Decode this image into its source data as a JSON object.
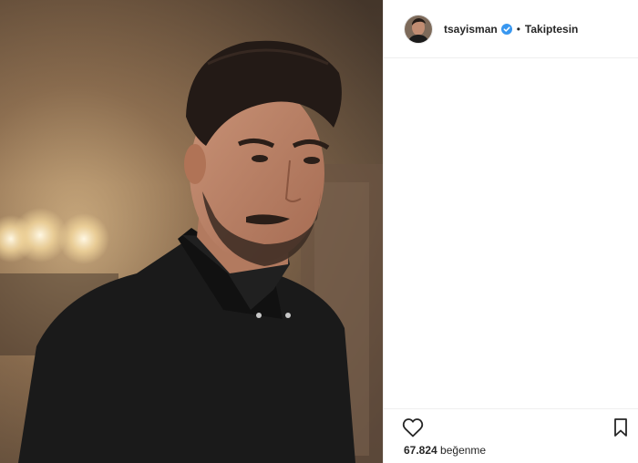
{
  "post": {
    "photo_alt": "",
    "author": {
      "username": "tsayisman",
      "verified": true,
      "follow_status": "Takiptesin"
    },
    "separator": "•",
    "likes": {
      "count": "67.824",
      "label": "beğenme"
    },
    "icons": {
      "like": "heart-outline-icon",
      "save": "bookmark-outline-icon",
      "verified": "verified-badge-icon"
    },
    "colors": {
      "text": "#262626",
      "verified": "#3897f0",
      "divider": "#efefef"
    }
  }
}
